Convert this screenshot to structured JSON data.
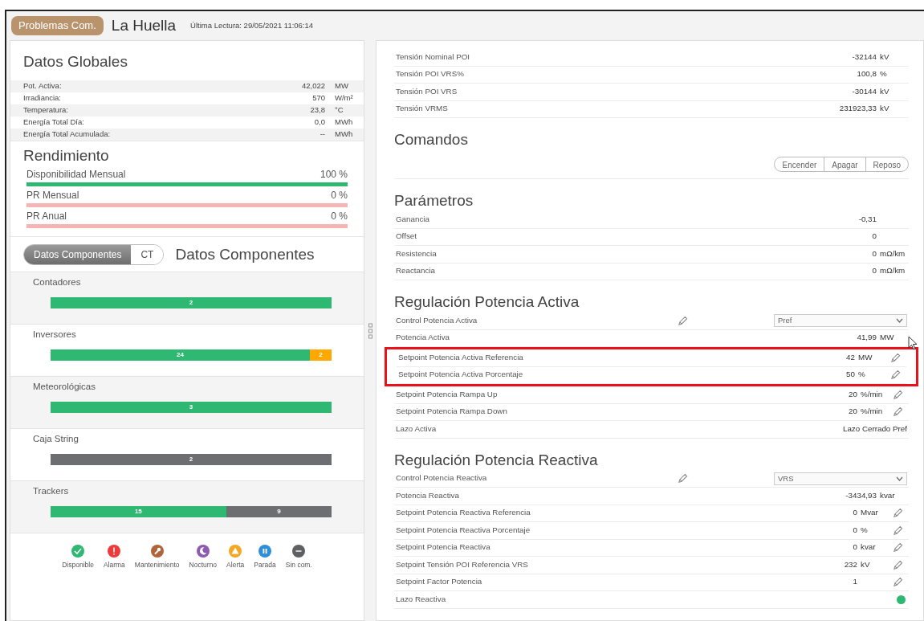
{
  "header": {
    "badge": "Problemas Com.",
    "title": "La Huella",
    "last_reading": "Última Lectura: 29/05/2021 11:06:14"
  },
  "global_data": {
    "title": "Datos Globales",
    "rows": [
      {
        "label": "Pot. Activa:",
        "value": "42,022",
        "unit": "MW"
      },
      {
        "label": "Irradiancia:",
        "value": "570",
        "unit": "W/m²"
      },
      {
        "label": "Temperatura:",
        "value": "23,8",
        "unit": "°C"
      },
      {
        "label": "Energía Total Día:",
        "value": "0,0",
        "unit": "MWh"
      },
      {
        "label": "Energía Total Acumulada:",
        "value": "--",
        "unit": "MWh"
      }
    ]
  },
  "performance": {
    "title": "Rendimiento",
    "rows": [
      {
        "label": "Disponibilidad Mensual",
        "value": "100 %",
        "level": 1
      },
      {
        "label": "PR Mensual",
        "value": "0 %",
        "level": 0
      },
      {
        "label": "PR Anual",
        "value": "0 %",
        "level": 0
      }
    ]
  },
  "components": {
    "tabs": [
      {
        "label": "Datos Componentes",
        "selected": true
      },
      {
        "label": "CT",
        "selected": false
      }
    ],
    "title": "Datos Componentes",
    "groups": [
      {
        "name": "Contadores",
        "segments": [
          {
            "count": "2",
            "color": "#2eb872"
          }
        ]
      },
      {
        "name": "Inversores",
        "segments": [
          {
            "count": "24",
            "color": "#2eb872"
          },
          {
            "count": "2",
            "color": "#ffa800"
          }
        ]
      },
      {
        "name": "Meteorológicas",
        "segments": [
          {
            "count": "3",
            "color": "#2eb872"
          }
        ]
      },
      {
        "name": "Caja String",
        "segments": [
          {
            "count": "2",
            "color": "#6d6e71"
          }
        ]
      },
      {
        "name": "Trackers",
        "segments": [
          {
            "count": "15",
            "color": "#2eb872"
          },
          {
            "count": "9",
            "color": "#6d6e71"
          }
        ]
      }
    ]
  },
  "legend": [
    {
      "label": "Disponible",
      "color": "#2eb872"
    },
    {
      "label": "Alarma",
      "color": "#ee3a3a"
    },
    {
      "label": "Mantenimiento",
      "color": "#b0643a"
    },
    {
      "label": "Nocturno",
      "color": "#8e5bb0"
    },
    {
      "label": "Alerta",
      "color": "#f5a623"
    },
    {
      "label": "Parada",
      "color": "#2e8fd8"
    },
    {
      "label": "Sin com.",
      "color": "#5f6062"
    }
  ],
  "sections": [
    {
      "rows": [
        {
          "kind": "value",
          "label": "Tensión Nominal POI",
          "value": "-32144",
          "unit": "kV",
          "editable": false,
          "highlighted": false
        },
        {
          "kind": "value",
          "label": "Tensión POI VRS%",
          "value": "100,8",
          "unit": "%",
          "editable": false,
          "highlighted": false
        },
        {
          "kind": "value",
          "label": "Tensión POI VRS",
          "value": "-30144",
          "unit": "kV",
          "editable": false,
          "highlighted": false
        },
        {
          "kind": "value",
          "label": "Tensión VRMS",
          "value": "231923,33",
          "unit": "kV",
          "editable": false,
          "highlighted": false
        }
      ]
    },
    {
      "title": "Comandos",
      "buttons": [
        "Encender",
        "Apagar",
        "Reposo"
      ]
    },
    {
      "title": "Parámetros",
      "rows": [
        {
          "kind": "value",
          "label": "Ganancia",
          "value": "-0,31",
          "editable": false,
          "highlighted": false
        },
        {
          "kind": "value",
          "label": "Offset",
          "value": "0",
          "editable": false,
          "highlighted": false
        },
        {
          "kind": "value",
          "label": "Resistencia",
          "value": "0",
          "unit": "mΩ/km",
          "editable": false,
          "highlighted": false
        },
        {
          "kind": "value",
          "label": "Reactancia",
          "value": "0",
          "unit": "mΩ/km",
          "editable": false,
          "highlighted": false
        }
      ]
    },
    {
      "title": "Regulación Potencia Activa",
      "rows": [
        {
          "kind": "select",
          "label": "Control Potencia Activa",
          "value": "Pref",
          "editable": true,
          "highlighted": false
        },
        {
          "kind": "value",
          "label": "Potencia Activa",
          "value": "41,99",
          "unit": "MW",
          "editable": false,
          "highlighted": false
        },
        {
          "kind": "value",
          "label": "Setpoint Potencia Activa Referencia",
          "value": "42",
          "unit": "MW",
          "editable": true,
          "highlighted": true
        },
        {
          "kind": "value",
          "label": "Setpoint Potencia Activa Porcentaje",
          "value": "50",
          "unit": "%",
          "editable": true,
          "highlighted": true
        },
        {
          "kind": "value",
          "label": "Setpoint Potencia Rampa Up",
          "value": "20",
          "unit": "%/min",
          "editable": true,
          "highlighted": false
        },
        {
          "kind": "value",
          "label": "Setpoint Potencia Rampa Down",
          "value": "20",
          "unit": "%/min",
          "editable": true,
          "highlighted": false
        },
        {
          "kind": "value",
          "label": "Lazo Activa",
          "value": "Lazo Cerrado Pref",
          "editable": false,
          "highlighted": false
        }
      ]
    },
    {
      "title": "Regulación Potencia Reactiva",
      "rows": [
        {
          "kind": "select",
          "label": "Control Potencia Reactiva",
          "value": "VRS",
          "editable": true,
          "highlighted": false
        },
        {
          "kind": "value",
          "label": "Potencia Reactiva",
          "value": "-3434,93",
          "unit": "kvar",
          "editable": false,
          "highlighted": false
        },
        {
          "kind": "value",
          "label": "Setpoint Potencia Reactiva Referencia",
          "value": "0",
          "unit": "Mvar",
          "editable": true,
          "highlighted": false
        },
        {
          "kind": "value",
          "label": "Setpoint Potencia Reactiva Porcentaje",
          "value": "0",
          "unit": "%",
          "editable": true,
          "highlighted": false
        },
        {
          "kind": "value",
          "label": "Setpoint Potencia Reactiva",
          "value": "0",
          "unit": "kvar",
          "editable": true,
          "highlighted": false
        },
        {
          "kind": "value",
          "label": "Setpoint Tensión POI Referencia VRS",
          "value": "232",
          "unit": "kV",
          "editable": true,
          "highlighted": false
        },
        {
          "kind": "value",
          "label": "Setpoint Factor Potencia",
          "value": "1",
          "editable": true,
          "highlighted": false
        },
        {
          "kind": "status",
          "label": "Lazo Reactiva",
          "color": "#2eb872",
          "highlighted": false
        }
      ]
    }
  ]
}
